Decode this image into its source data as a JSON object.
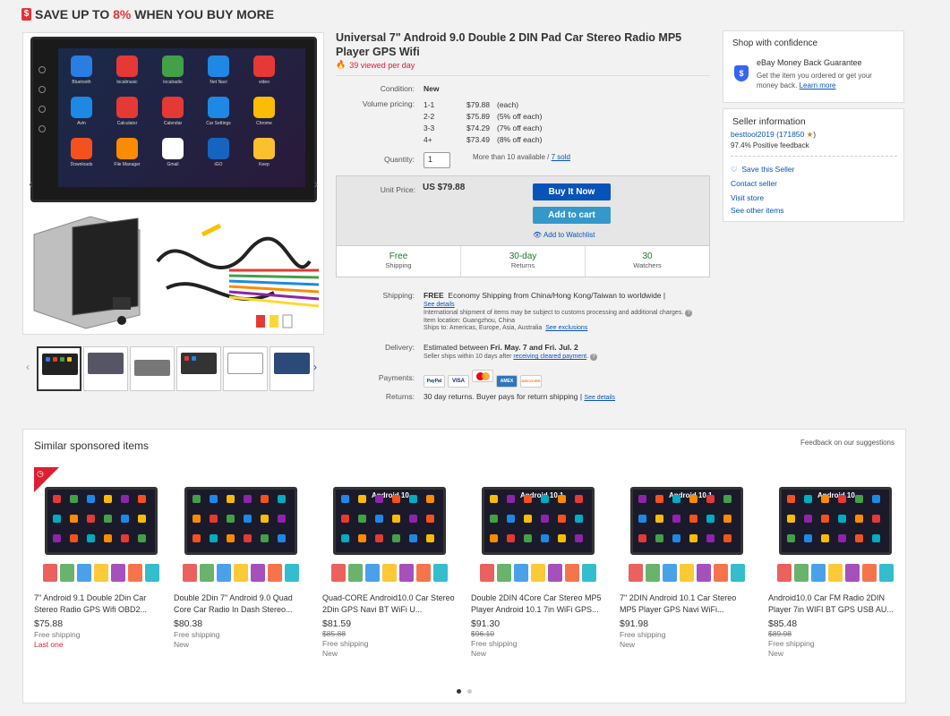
{
  "banner": {
    "prefix": "SAVE UP TO ",
    "percent": "8%",
    "suffix": " WHEN YOU BUY MORE"
  },
  "product": {
    "title": "Universal 7\" Android 9.0 Double 2 DIN Pad Car Stereo Radio MP5 Player GPS Wifi",
    "viewed": "39 viewed per day"
  },
  "details": {
    "condition_label": "Condition:",
    "condition": "New",
    "volume_label": "Volume pricing:",
    "volume_tiers": [
      {
        "qty": "1-1",
        "price": "$79.88",
        "note": "(each)"
      },
      {
        "qty": "2-2",
        "price": "$75.89",
        "note": "(5% off each)"
      },
      {
        "qty": "3-3",
        "price": "$74.29",
        "note": "(7% off each)"
      },
      {
        "qty": "4+",
        "price": "$73.49",
        "note": "(8% off each)"
      }
    ],
    "quantity_label": "Quantity:",
    "quantity_value": "1",
    "available": "More than 10 available / ",
    "sold": "7 sold"
  },
  "buybox": {
    "unit_price_label": "Unit Price:",
    "unit_price": "US $79.88",
    "buy_now": "Buy It Now",
    "add_to_cart": "Add to cart",
    "add_to_watchlist": "Add to Watchlist",
    "stats": [
      {
        "value": "Free",
        "label": "Shipping"
      },
      {
        "value": "30-day",
        "label": "Returns"
      },
      {
        "value": "30",
        "label": "Watchers"
      }
    ]
  },
  "shipping": {
    "label": "Shipping:",
    "free": "FREE",
    "method": "Economy Shipping from China/Hong Kong/Taiwan to worldwide |",
    "see_details": "See details",
    "intl_note": "International shipment of items may be subject to customs processing and additional charges.",
    "location_label": "Item location:",
    "location": "Guangzhou, China",
    "ships_to_label": "Ships to:",
    "ships_to": "Americas, Europe, Asia, Australia",
    "exclusions": "See exclusions"
  },
  "delivery": {
    "label": "Delivery:",
    "prefix": "Estimated between ",
    "dates": "Fri. May. 7 and Fri. Jul. 2",
    "note": "Seller ships within 10 days after ",
    "note_link": "receiving cleared payment",
    "note_end": "."
  },
  "payments": {
    "label": "Payments:",
    "methods": [
      "PayPal",
      "VISA",
      "MC",
      "AMEX",
      "DISCOVER"
    ]
  },
  "returns": {
    "label": "Returns:",
    "text": "30 day returns. Buyer pays for return shipping |",
    "see_details": "See details"
  },
  "confidence": {
    "title": "Shop with confidence",
    "guarantee": "eBay Money Back Guarantee",
    "desc": "Get the item you ordered or get your money back.",
    "learn_more": "Learn more"
  },
  "seller": {
    "title": "Seller information",
    "name": "besttool2019",
    "score": "(171850",
    "score_end": ")",
    "feedback": "97.4% Positive feedback",
    "save": "Save this Seller",
    "contact": "Contact seller",
    "visit": "Visit store",
    "other": "See other items"
  },
  "similar": {
    "title": "Similar sponsored items",
    "feedback": "Feedback on our suggestions",
    "items": [
      {
        "name": "7\" Android 9.1 Double 2Din Car Stereo Radio GPS Wifi OBD2...",
        "price": "$75.88",
        "old": "",
        "ship": "Free shipping",
        "cond": "Last one"
      },
      {
        "name": "Double 2Din 7\" Android 9.0 Quad Core Car Radio In Dash Stereo...",
        "price": "$80.38",
        "old": "",
        "ship": "Free shipping",
        "cond": "New"
      },
      {
        "name": "Quad-CORE Android10.0 Car Stereo 2Din GPS Navi BT WiFi U...",
        "price": "$81.59",
        "old": "$85.88",
        "ship": "Free shipping",
        "cond": "New"
      },
      {
        "name": "Double 2DIN 4Core Car Stereo MP5 Player Android 10.1 7in WiFi GPS...",
        "price": "$91.30",
        "old": "$96.10",
        "ship": "Free shipping",
        "cond": "New"
      },
      {
        "name": "7\" 2DIN Android 10.1 Car Stereo MP5 Player GPS Navi WiFi...",
        "price": "$91.98",
        "old": "",
        "ship": "Free shipping",
        "cond": "New"
      },
      {
        "name": "Android10.0 Car FM Radio 2DIN Player 7in WIFI BT GPS USB AU...",
        "price": "$85.48",
        "old": "$89.98",
        "ship": "Free shipping",
        "cond": "New"
      }
    ],
    "screen_labels": [
      "",
      "",
      "Android 10",
      "Android 10.1",
      "Android 10.1",
      "Android 10"
    ]
  },
  "gallery": {
    "apps": [
      "Bluetooth",
      "localmusic",
      "localradio",
      "Net Navi",
      "video",
      "Avin",
      "Calculator",
      "Calendar",
      "Car Settings",
      "Chrome",
      "Downloads",
      "File Manager",
      "Gmail",
      "iGO",
      "Keep"
    ],
    "app_colors": [
      "#2a7de1",
      "#e53935",
      "#43a047",
      "#1e88e5",
      "#e53935",
      "#1e88e5",
      "#e53935",
      "#e53935",
      "#1e88e5",
      "#fbbc05",
      "#f4511e",
      "#fb8c00",
      "#ffffff",
      "#1565c0",
      "#fbc02d"
    ]
  }
}
